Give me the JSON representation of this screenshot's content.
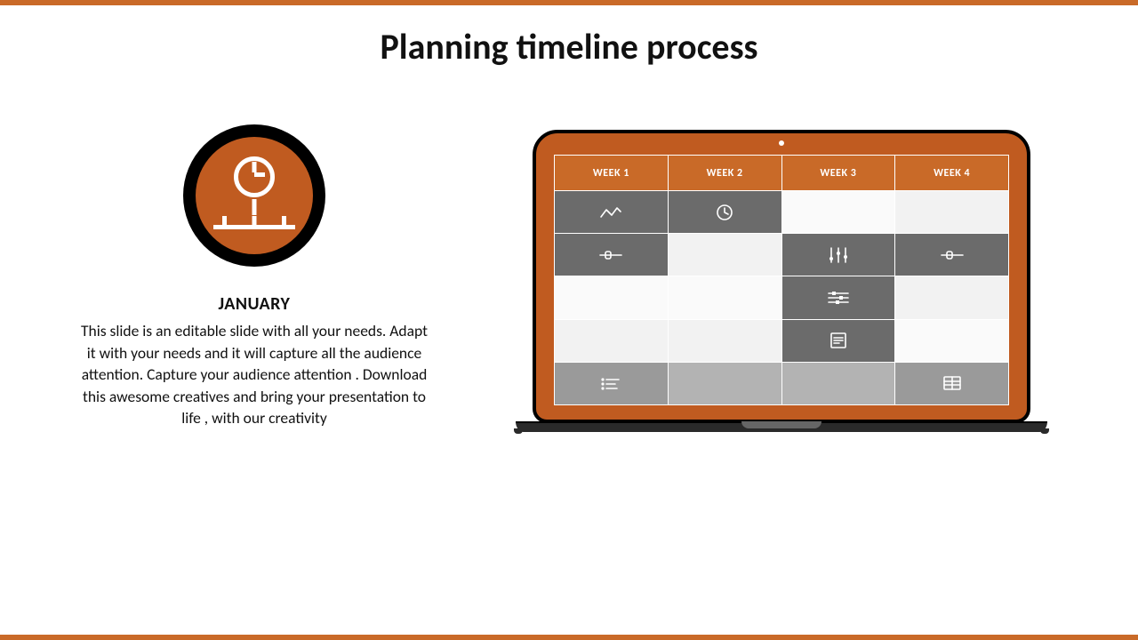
{
  "title": "Planning timeline process",
  "left": {
    "month": "JANUARY",
    "description": "This slide is an editable slide with all your needs. Adapt it with your needs and it will capture all the audience attention. Capture your audience attention . Download this awesome creatives and bring your presentation to life , with our creativity"
  },
  "weeks": {
    "col1": "WEEK 1",
    "col2": "WEEK 2",
    "col3": "WEEK 3",
    "col4": "WEEK 4"
  },
  "grid": [
    [
      {
        "shade": "dark",
        "icon": "line-chart"
      },
      {
        "shade": "dark",
        "icon": "clock"
      },
      {
        "shade": "lighter",
        "icon": null
      },
      {
        "shade": "light",
        "icon": null
      }
    ],
    [
      {
        "shade": "dark",
        "icon": "slider"
      },
      {
        "shade": "light",
        "icon": null
      },
      {
        "shade": "dark",
        "icon": "bars"
      },
      {
        "shade": "dark",
        "icon": "slider"
      }
    ],
    [
      {
        "shade": "lighter",
        "icon": null
      },
      {
        "shade": "lighter",
        "icon": null
      },
      {
        "shade": "dark",
        "icon": "sliders-h"
      },
      {
        "shade": "light",
        "icon": null
      }
    ],
    [
      {
        "shade": "light",
        "icon": null
      },
      {
        "shade": "light",
        "icon": null
      },
      {
        "shade": "dark",
        "icon": "document"
      },
      {
        "shade": "lighter",
        "icon": null
      }
    ],
    [
      {
        "shade": "mid",
        "icon": "list"
      },
      {
        "shade": "mid2",
        "icon": null
      },
      {
        "shade": "mid2",
        "icon": null
      },
      {
        "shade": "mid",
        "icon": "columns"
      }
    ]
  ],
  "colors": {
    "accent": "#c05b20"
  }
}
